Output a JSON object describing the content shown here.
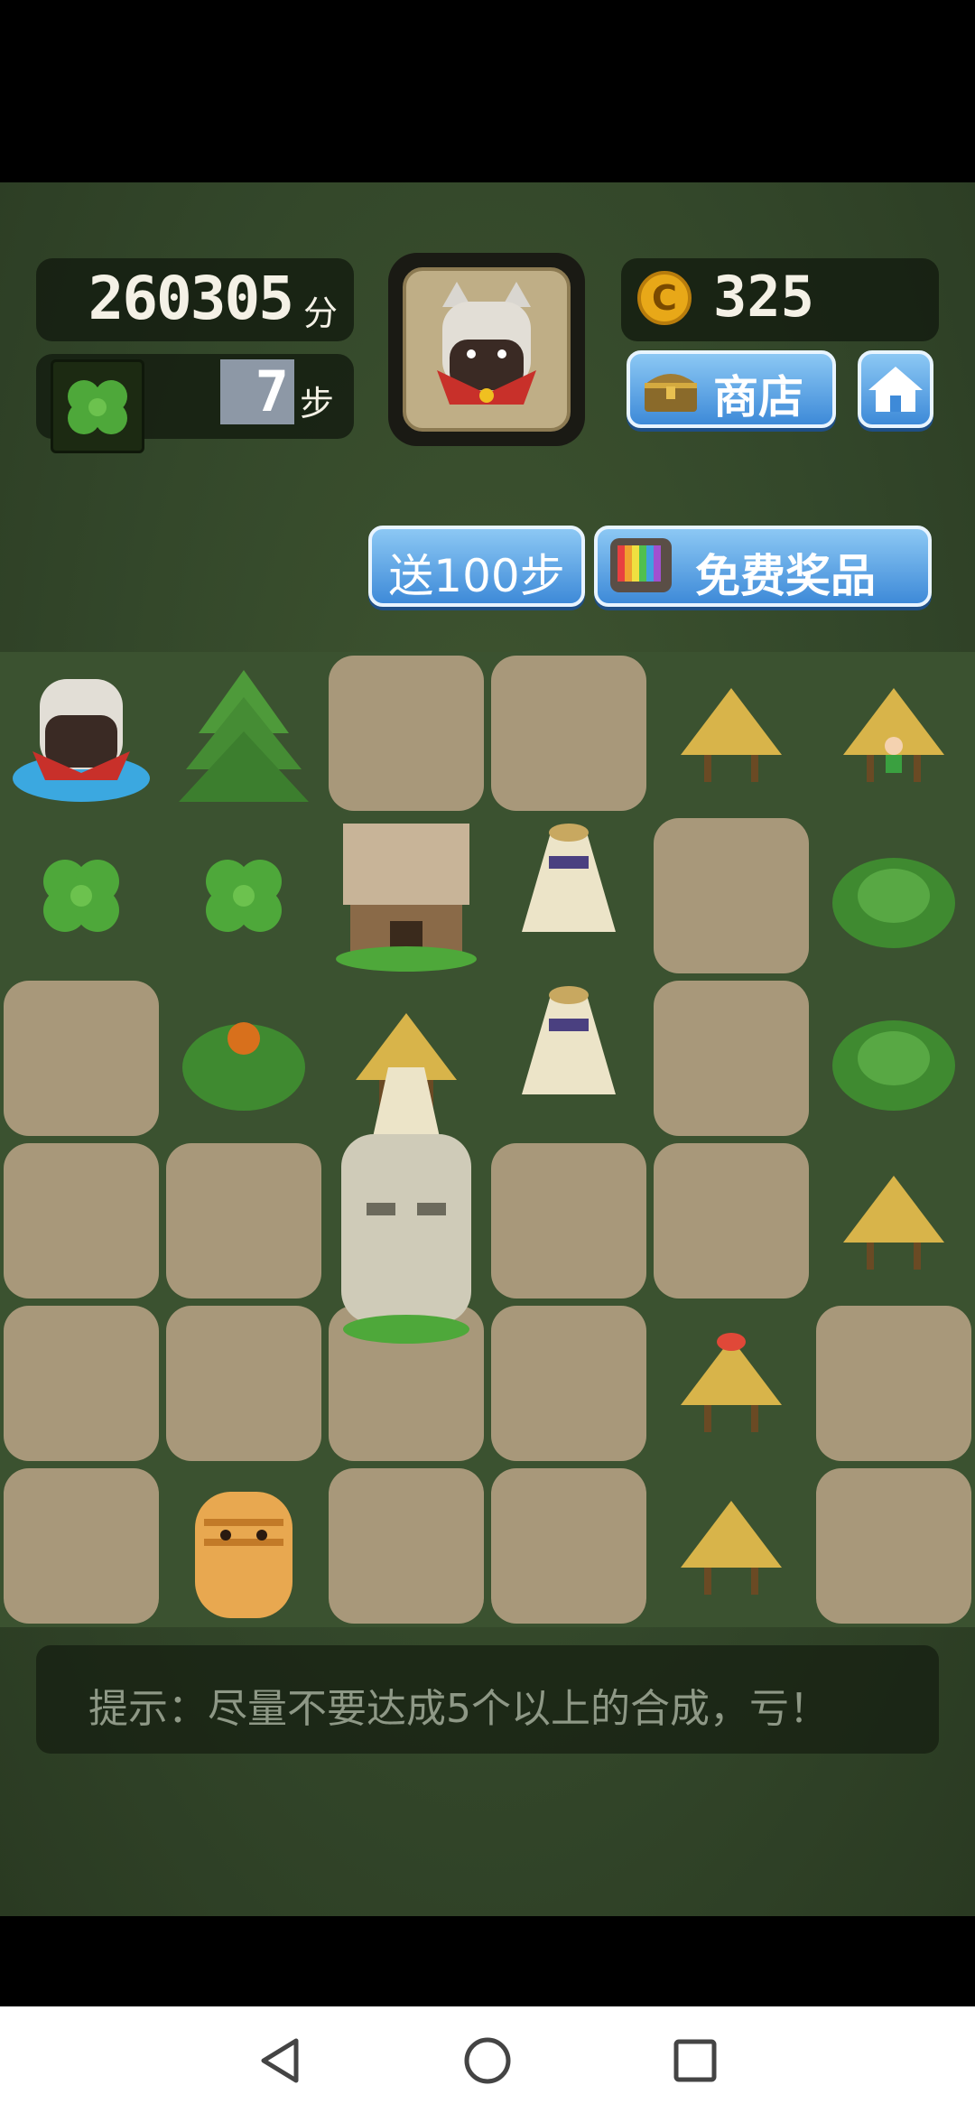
{
  "hud": {
    "score": "260305",
    "score_unit": "分",
    "steps": "7",
    "steps_unit": "步",
    "coins": "325",
    "coin_symbol": "C",
    "shop_label": "商店",
    "gift_steps_label": "送100步",
    "free_prize_label": "免费奖品"
  },
  "next_piece": "cat-bear-icon",
  "stash_piece": "clover-icon",
  "hint": "提示：尽量不要达成5个以上的合成，亏！",
  "board": {
    "rows": 6,
    "cols": 6,
    "cells": [
      [
        "cat-bear-icon",
        "pine-tree-icon",
        "path",
        "path",
        "grass-hut-icon",
        "grass-hut-villager-icon"
      ],
      [
        "clover-icon",
        "clover-icon",
        "mansion-icon",
        "tower-hut-icon",
        "path",
        "bush-icon"
      ],
      [
        "path",
        "bush-berry-icon",
        "grass-hut-icon",
        "tower-hut-icon",
        "path",
        "bush-icon"
      ],
      [
        "path",
        "path",
        "stone-head-icon",
        "path",
        "path",
        "grass-hut-icon"
      ],
      [
        "path",
        "path",
        "path",
        "path",
        "grass-hut-dome-icon",
        "path"
      ],
      [
        "path",
        "tiger-bear-icon",
        "path",
        "path",
        "grass-hut-icon",
        "path"
      ]
    ]
  },
  "colors": {
    "grass": "#3b5230",
    "path": "#a8987a",
    "button_blue": "#4a94de",
    "coin_gold": "#e8a818"
  }
}
